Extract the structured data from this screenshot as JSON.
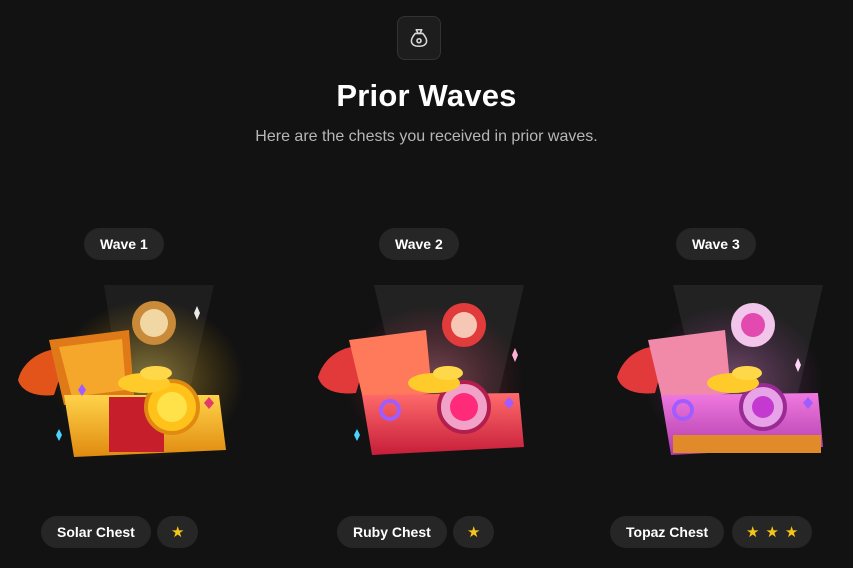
{
  "header": {
    "icon": "money-bag-icon",
    "title": "Prior Waves",
    "subtitle": "Here are the chests you received in prior waves."
  },
  "waves": [
    {
      "label": "Wave 1",
      "chest_name": "Solar Chest",
      "stars": 1,
      "star_glyph": "★",
      "accent": "#f2b01e"
    },
    {
      "label": "Wave 2",
      "chest_name": "Ruby Chest",
      "stars": 1,
      "star_glyph": "★",
      "accent": "#e23b6a"
    },
    {
      "label": "Wave 3",
      "chest_name": "Topaz Chest",
      "stars": 3,
      "star_glyph": "★",
      "accent": "#e56bd8"
    }
  ],
  "colors": {
    "background": "#121212",
    "pill": "#262626",
    "star": "#f5c518"
  }
}
